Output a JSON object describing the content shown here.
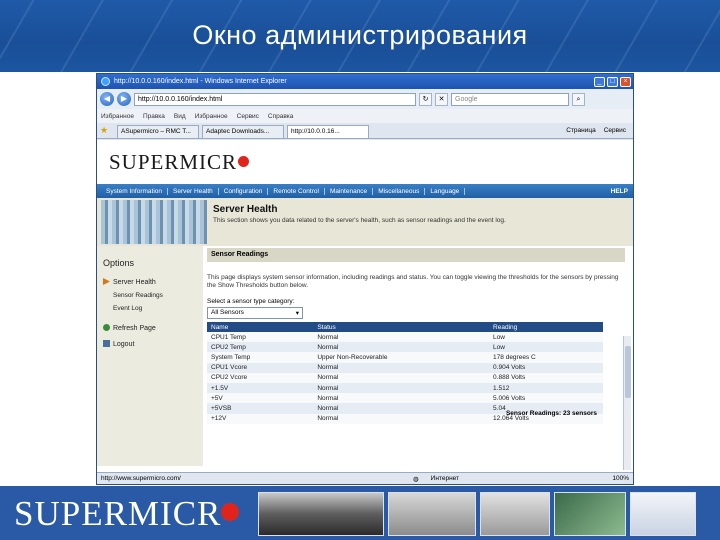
{
  "slide": {
    "title": "Окно администрирования"
  },
  "browser": {
    "window_title": "http://10.0.0.160/index.html - Windows Internet Explorer",
    "address": "http://10.0.0.160/index.html",
    "search_placeholder": "Google",
    "favorites": [
      "Избранное",
      "Правка",
      "Вид",
      "Избранное",
      "Сервис",
      "Справка"
    ],
    "tabs": [
      "ASupermicro – RMC T...",
      "Adaptec Downloads...",
      "http://10.0.0.16..."
    ],
    "tools": [
      "Страница",
      "Сервис"
    ],
    "status_url": "http://www.supermicro.com/",
    "status_zone": "Интернет",
    "zoom": "100%"
  },
  "app": {
    "logo": "SUPERMICR",
    "menu": [
      "System Information",
      "Server Health",
      "Configuration",
      "Remote Control",
      "Maintenance",
      "Miscellaneous",
      "Language"
    ],
    "help": "HELP",
    "banner_title": "Server Health",
    "banner_desc": "This section shows you data related to the server's health, such as sensor readings and the event log.",
    "options_title": "Options",
    "options": [
      {
        "label": "Server Health"
      },
      {
        "label": "Sensor Readings"
      },
      {
        "label": "Event Log"
      },
      {
        "label": "Refresh Page"
      },
      {
        "label": "Logout"
      }
    ],
    "section_title": "Sensor Readings",
    "section_desc": "This page displays system sensor information, including readings and status. You can toggle viewing the thresholds for the sensors by pressing the Show Thresholds button below.",
    "select_label": "Select a sensor type category:",
    "select_value": "All Sensors",
    "readings_count": "Sensor Readings: 23 sensors",
    "columns": [
      "Name",
      "Status",
      "Reading"
    ],
    "rows": [
      [
        "CPU1 Temp",
        "Normal",
        "Low"
      ],
      [
        "CPU2 Temp",
        "Normal",
        "Low"
      ],
      [
        "System Temp",
        "Upper Non-Recoverable",
        "178 degrees C"
      ],
      [
        "CPU1 Vcore",
        "Normal",
        "0.904 Volts"
      ],
      [
        "CPU2 Vcore",
        "Normal",
        "0.888 Volts"
      ],
      [
        "+1.5V",
        "Normal",
        "1.512"
      ],
      [
        "+5V",
        "Normal",
        "5.006 Volts"
      ],
      [
        "+5VSB",
        "Normal",
        "5.04"
      ],
      [
        "+12V",
        "Normal",
        "12.064 Volts"
      ]
    ]
  },
  "footer": {
    "logo": "SUPERMICR"
  }
}
